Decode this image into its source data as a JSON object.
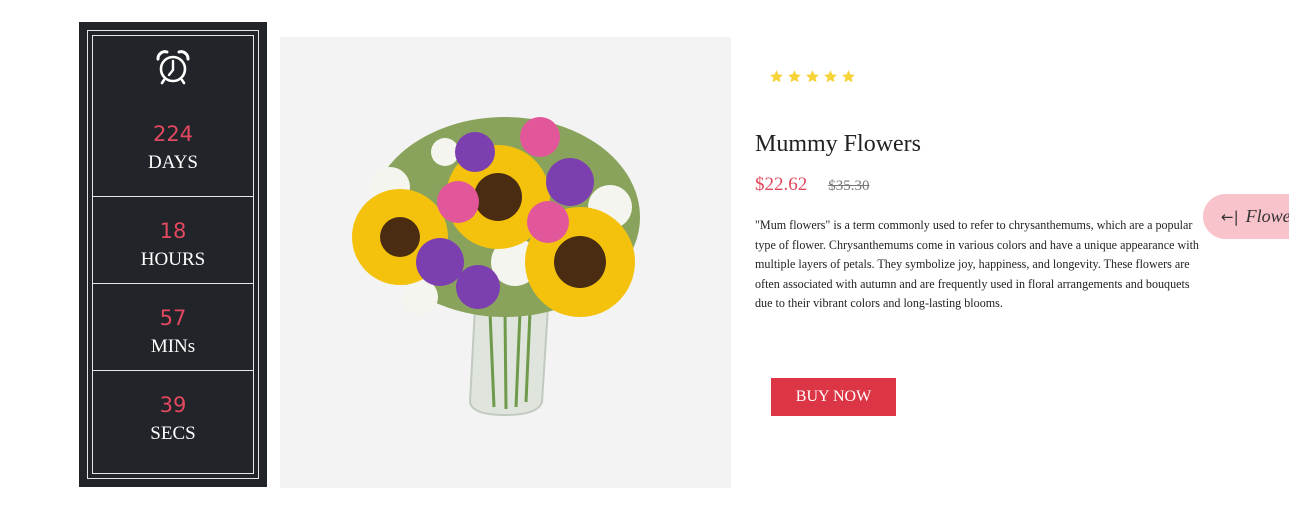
{
  "countdown": {
    "icon": "alarm-clock-icon",
    "days": {
      "value": "224",
      "label": "DAYS"
    },
    "hours": {
      "value": "18",
      "label": "HOURS"
    },
    "mins": {
      "value": "57",
      "label": "MINs"
    },
    "secs": {
      "value": "39",
      "label": "SECS"
    }
  },
  "product": {
    "image_icon": "flower-bouquet-image",
    "rating": 5,
    "title": "Mummy Flowers",
    "price": "$22.62",
    "old_price": "$35.30",
    "description": "\"Mum flowers\" is a term commonly used to refer to chrysanthemums, which are a popular type of flower. Chrysanthemums come in various colors and have a unique appearance with multiple layers of petals. They symbolize joy, happiness, and longevity. These flowers are often associated with autumn and are frequently used in floral arrangements and bouquets due to their vibrant colors and long-lasting blooms.",
    "buy_label": "BUY NOW"
  },
  "side_tab": {
    "arrow": "←|",
    "label": "Flowers"
  },
  "colors": {
    "accent": "#e2485f",
    "button": "#dc3545",
    "panel": "#212429",
    "star": "#f7d33a",
    "tab": "#f9c3cc"
  }
}
